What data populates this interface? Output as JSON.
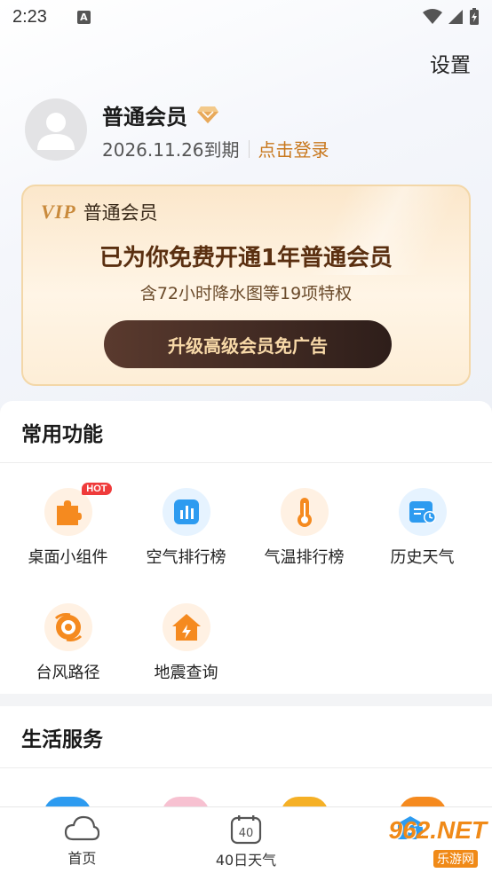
{
  "status_bar": {
    "time": "2:23",
    "notification_icon": "a-icon"
  },
  "header": {
    "settings_label": "设置"
  },
  "profile": {
    "member_title": "普通会员",
    "expiry": "2026.11.26到期",
    "login_link": "点击登录"
  },
  "vip_card": {
    "logo": "VIP",
    "name": "普通会员",
    "headline": "已为你免费开通1年普通会员",
    "subline": "含72小时降水图等19项特权",
    "upgrade_button": "升级高级会员免广告"
  },
  "common_functions": {
    "title": "常用功能",
    "hot_badge": "HOT",
    "items": [
      {
        "label": "桌面小组件",
        "icon": "puzzle-icon"
      },
      {
        "label": "空气排行榜",
        "icon": "air-chart-icon"
      },
      {
        "label": "气温排行榜",
        "icon": "thermometer-icon"
      },
      {
        "label": "历史天气",
        "icon": "history-calendar-icon"
      },
      {
        "label": "台风路径",
        "icon": "typhoon-icon"
      },
      {
        "label": "地震查询",
        "icon": "earthquake-icon"
      }
    ]
  },
  "life_services": {
    "title": "生活服务"
  },
  "bottom_nav": {
    "items": [
      {
        "label": "首页",
        "icon": "cloud-icon"
      },
      {
        "label": "40日天气",
        "icon": "calendar-40-icon",
        "badge": "40"
      },
      {
        "label": "",
        "icon": "profile-icon"
      }
    ]
  },
  "watermark": {
    "text": "962.NET",
    "sub": "乐游网"
  }
}
